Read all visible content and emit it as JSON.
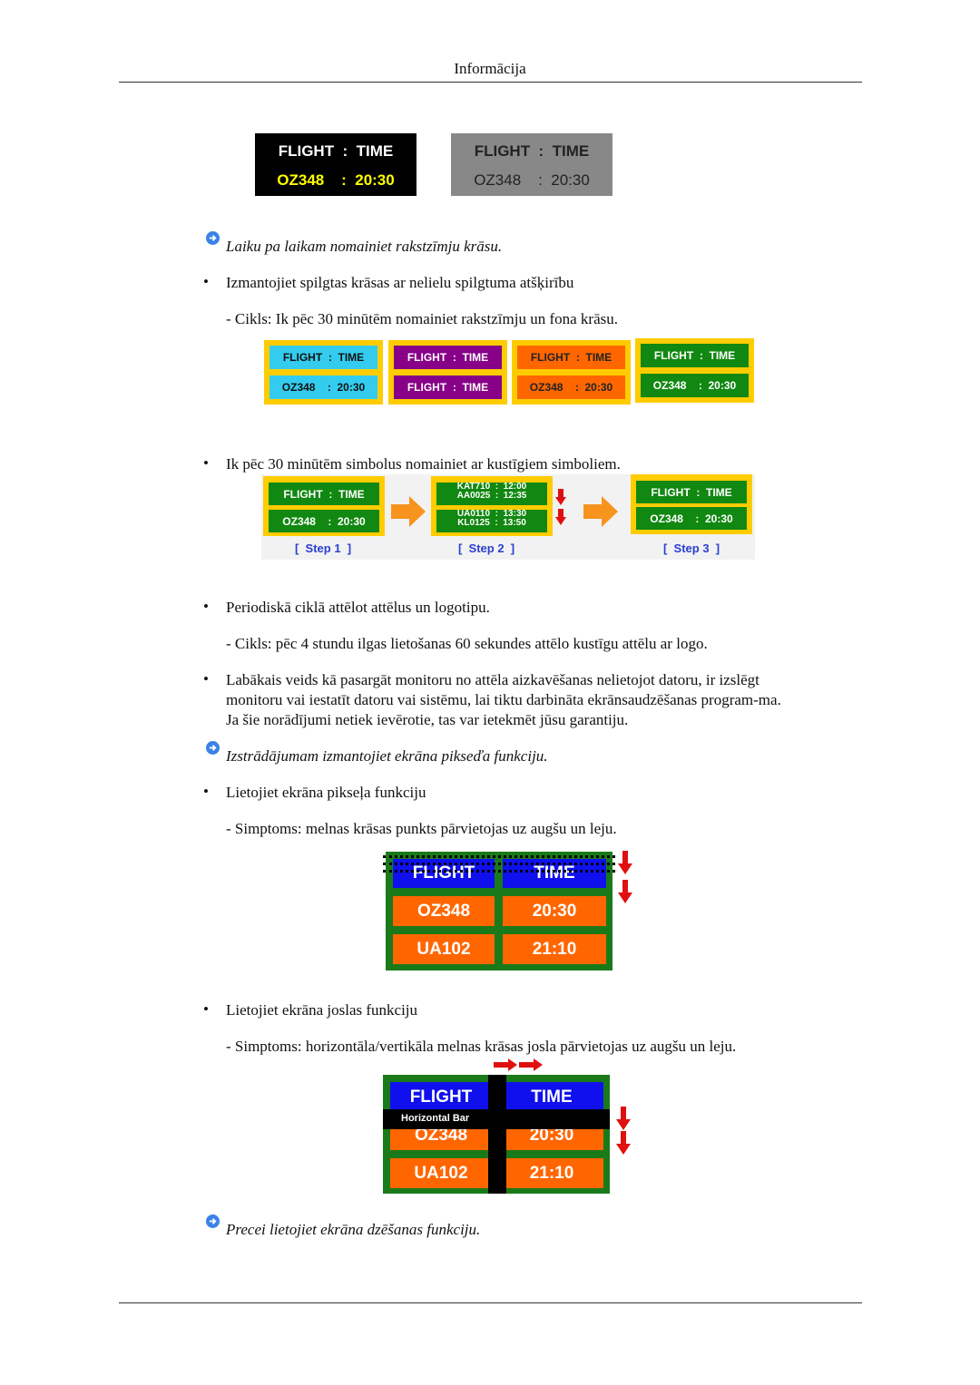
{
  "header": {
    "title": "Informācija"
  },
  "panels_top": {
    "dark": {
      "line1": "FLIGHT  :  TIME",
      "line2": "OZ348    :  20:30",
      "bg": "#000000",
      "line1_color": "#ffffff",
      "line2_color": "#ffff00"
    },
    "gray": {
      "line1": "FLIGHT  :  TIME",
      "line2": "OZ348    :  20:30",
      "bg": "#888888",
      "text_color": "#222222"
    }
  },
  "notes": [
    {
      "text": "Laiku pa laikam nomainiet rakstzīmju krāsu."
    },
    {
      "text": "Izstrādājumam izmantojiet ekrāna pikseďa funkciju."
    },
    {
      "text": "Precei lietojiet ekrāna dzēšanas funkciju."
    }
  ],
  "section1": {
    "bullet": "Izmantojiet spilgtas krāsas ar nelielu spilgtuma atšķirību",
    "sub": "- Cikls: Ik pēc 30 minūtēm nomainiet rakstzīmju un fona krāsu."
  },
  "color_cycle": [
    {
      "top": "FLIGHT  :  TIME",
      "bottom": "OZ348    :  20:30",
      "bg": "#33ccee",
      "fg": "#111111"
    },
    {
      "top": "FLIGHT  :  TIME",
      "bottom": "FLIGHT  :  TIME",
      "bg": "#880088",
      "fg": "#ffffff"
    },
    {
      "top": "FLIGHT  :  TIME",
      "bottom": "OZ348    :  20:30",
      "bg": "#ff6600",
      "fg": "#222222"
    },
    {
      "top": "FLIGHT  :  TIME",
      "bottom": "OZ348    :  20:30",
      "bg": "#118811",
      "fg": "#ffffff"
    }
  ],
  "section2": {
    "bullet": "Ik pēc 30 minūtēm simbolus nomainiet ar kustīgiem simboliem.",
    "steps": [
      {
        "label": "[  Step 1  ]",
        "top": "FLIGHT  :  TIME",
        "bottom": "OZ348    :  20:30"
      },
      {
        "label": "[  Step 2  ]",
        "top_a": "KAT710  :  12:00",
        "top_b": "AA0025  :  12:35",
        "bottom_a": "UA0110  :  13:30",
        "bottom_b": "KL0125  :  13:50"
      },
      {
        "label": "[  Step 3  ]",
        "top": "FLIGHT  :  TIME",
        "bottom": "OZ348    :  20:30"
      }
    ]
  },
  "section3": {
    "bullet": "Periodiskā ciklā attēlot attēlus un logotipu.",
    "sub": "- Cikls: pēc 4 stundu ilgas lietošanas 60 sekundes attēlo kustīgu attēlu ar logo."
  },
  "section4": {
    "bullet": "Labākais veids kā pasargāt monitoru no attēla aizkavēšanas nelietojot datoru, ir izslēgt monitoru vai iestatīt datoru vai sistēmu, lai tiktu darbināta ekrānsaudzēšanas program-ma. Ja šie norādījumi netiek ievērotie, tas var ietekmēt jūsu garantiju."
  },
  "section5": {
    "bullet": "Lietojiet ekrāna pikseļa funkciju",
    "sub": "- Simptoms: melnas krāsas punkts pārvietojas uz augšu un leju."
  },
  "board": {
    "header": [
      "FLIGHT",
      "TIME"
    ],
    "rows": [
      [
        "OZ348",
        "20:30"
      ],
      [
        "UA102",
        "21:10"
      ]
    ],
    "frame_color": "#1a7a1a",
    "header_bg": "#1010ee",
    "row_bg": "#ff6600"
  },
  "section6": {
    "bullet": "Lietojiet ekrāna joslas funkciju",
    "sub": "- Simptoms: horizontāla/vertikāla melnas krāsas josla pārvietojas uz augšu un leju.",
    "bar_label": "Horizontal Bar"
  },
  "bullet_char": "•"
}
